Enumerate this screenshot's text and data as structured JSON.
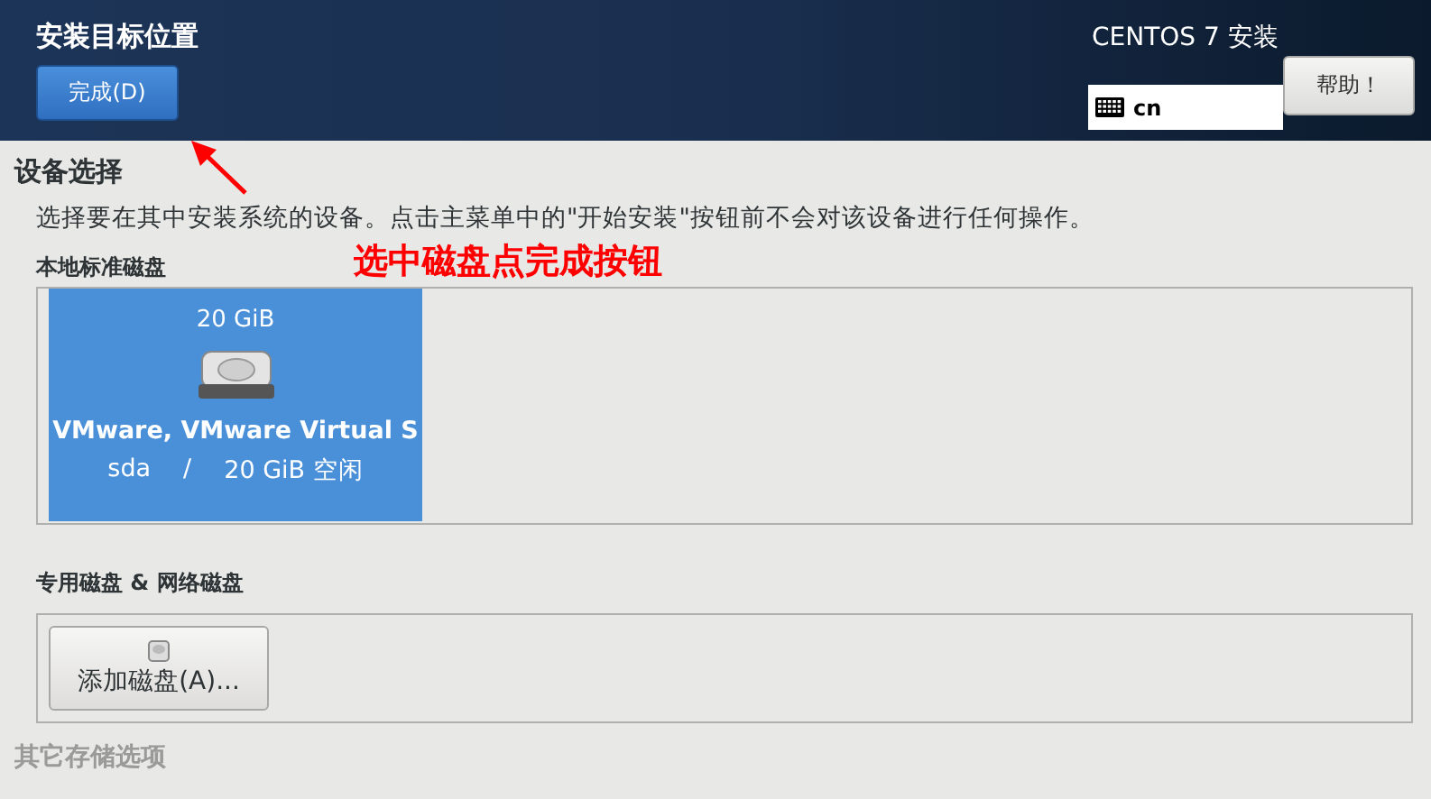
{
  "header": {
    "title": "安装目标位置",
    "done_button": "完成(D)",
    "product": "CENTOS 7 安装",
    "keyboard": {
      "value": "cn"
    },
    "help_button": "帮助！"
  },
  "device_selection": {
    "heading": "设备选择",
    "description": "选择要在其中安装系统的设备。点击主菜单中的\"开始安装\"按钮前不会对该设备进行任何操作。",
    "local_disks": {
      "heading": "本地标准磁盘",
      "disks": [
        {
          "size": "20 GiB",
          "name": "VMware, VMware Virtual S",
          "device": "sda",
          "separator": "/",
          "free": "20 GiB 空闲",
          "selected": true
        }
      ]
    },
    "special_disks": {
      "heading": "专用磁盘 & 网络磁盘",
      "add_button": "添加磁盘(A)..."
    },
    "other_options_heading": "其它存储选项"
  },
  "annotation": {
    "text": "选中磁盘点完成按钮"
  }
}
